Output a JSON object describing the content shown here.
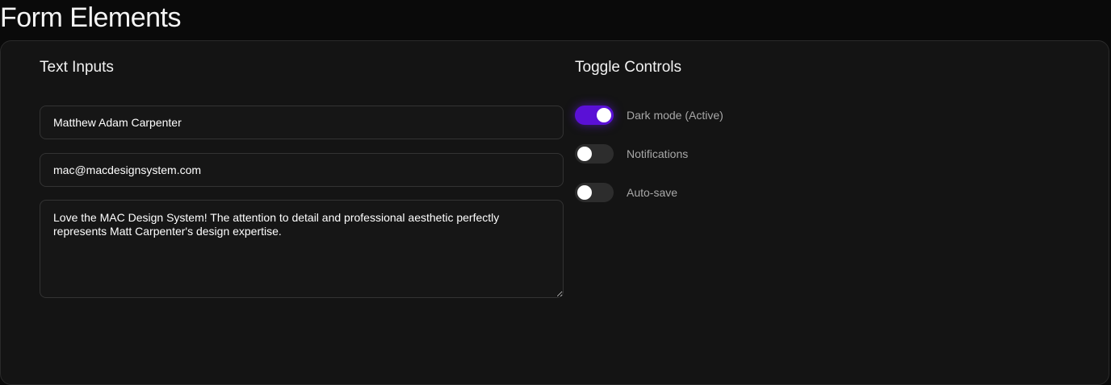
{
  "page": {
    "title": "Form Elements"
  },
  "text_inputs": {
    "heading": "Text Inputs",
    "name_value": "Matthew Adam Carpenter",
    "email_value": "mac@macdesignsystem.com",
    "message_value": "Love the MAC Design System! The attention to detail and professional aesthetic perfectly represents Matt Carpenter's design expertise."
  },
  "toggle_controls": {
    "heading": "Toggle Controls",
    "items": [
      {
        "label": "Dark mode (Active)",
        "on": true
      },
      {
        "label": "Notifications",
        "on": false
      },
      {
        "label": "Auto-save",
        "on": false
      }
    ]
  },
  "colors": {
    "accent": "#5a10d6",
    "background": "#0a0a0a",
    "card": "#141414"
  }
}
